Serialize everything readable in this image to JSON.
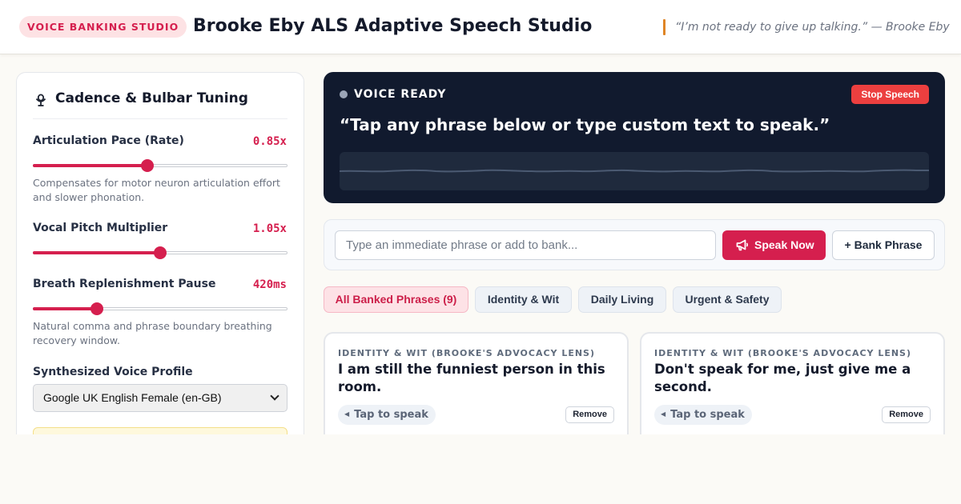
{
  "header": {
    "badge": "VOICE BANKING STUDIO",
    "title": "Brooke Eby ALS Adaptive Speech Studio",
    "quote": "“I’m not ready to give up talking.” — Brooke Eby"
  },
  "controls": {
    "title": "Cadence & Bulbar Tuning",
    "rate": {
      "label": "Articulation Pace (Rate)",
      "value_text": "0.85x",
      "level": 0.45,
      "help": "Compensates for motor neuron articulation effort and slower phonation."
    },
    "pitch": {
      "label": "Vocal Pitch Multiplier",
      "value_text": "1.05x",
      "level": 0.5
    },
    "pause": {
      "label": "Breath Replenishment Pause",
      "value_text": "420ms",
      "level": 0.25,
      "help": "Natural comma and phrase boundary breathing recovery window."
    },
    "voice": {
      "label": "Synthesized Voice Profile",
      "selected": "Google UK English Female (en-GB)"
    }
  },
  "status": {
    "label": "VOICE READY",
    "stop_label": "Stop Speech",
    "current_phrase": "“Tap any phrase below or type custom text to speak.”"
  },
  "input": {
    "placeholder": "Type an immediate phrase or add to bank...",
    "value": "",
    "speak_label": "Speak Now",
    "bank_label": "+ Bank Phrase"
  },
  "filters": {
    "tabs": [
      {
        "label": "All Banked Phrases (9)",
        "active": true
      },
      {
        "label": "Identity & Wit",
        "active": false
      },
      {
        "label": "Daily Living",
        "active": false
      },
      {
        "label": "Urgent & Safety",
        "active": false
      }
    ]
  },
  "phrases": [
    {
      "category": "IDENTITY & WIT (BROOKE'S ADVOCACY LENS)",
      "text": "I am still the funniest person in this room.",
      "tap_label": "Tap to speak",
      "remove_label": "Remove"
    },
    {
      "category": "IDENTITY & WIT (BROOKE'S ADVOCACY LENS)",
      "text": "Don't speak for me, just give me a second.",
      "tap_label": "Tap to speak",
      "remove_label": "Remove"
    }
  ],
  "colors": {
    "accent": "#d51f4e",
    "status_card": "#111a2e",
    "stop": "#ec3f3f",
    "quote_bar": "#df8526"
  },
  "icons": {
    "controls": "microphone-stand-icon",
    "status": "status-dot-icon",
    "speak": "megaphone-icon",
    "tap": "speaker-icon",
    "select": "chevron-down-icon"
  }
}
